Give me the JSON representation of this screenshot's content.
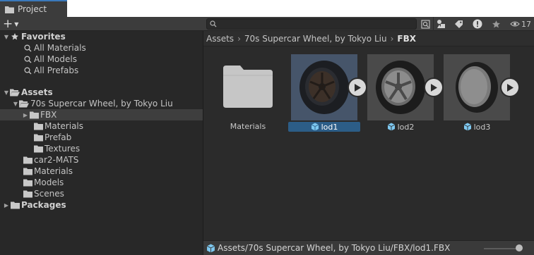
{
  "window": {
    "tab_label": "Project"
  },
  "toolbar": {
    "add_symbol": "+",
    "search_value": "",
    "hidden_packages_count": "17"
  },
  "sidebar": {
    "favorites": {
      "label": "Favorites",
      "items": [
        "All Materials",
        "All Models",
        "All Prefabs"
      ]
    },
    "assets": {
      "label": "Assets",
      "pack": "70s Supercar Wheel, by Tokyo Liu",
      "pack_children": [
        "FBX",
        "Materials",
        "Prefab",
        "Textures"
      ],
      "others": [
        "car2-MATS",
        "Materials",
        "Models",
        "Scenes"
      ]
    },
    "packages": {
      "label": "Packages"
    }
  },
  "breadcrumb": [
    "Assets",
    "70s Supercar Wheel, by Tokyo Liu",
    "FBX"
  ],
  "grid": {
    "items": [
      {
        "label": "Materials",
        "kind": "folder"
      },
      {
        "label": "lod1",
        "kind": "model",
        "selected": true
      },
      {
        "label": "lod2",
        "kind": "model"
      },
      {
        "label": "lod3",
        "kind": "model"
      }
    ]
  },
  "status": {
    "path": "Assets/70s Supercar Wheel, by Tokyo Liu/FBX/lod1.FBX"
  },
  "thumbnail_size": {
    "fraction": 0.85
  },
  "colors": {
    "selection": "#2c5d87",
    "accent": "#3a79bb",
    "panel": "#282828"
  }
}
